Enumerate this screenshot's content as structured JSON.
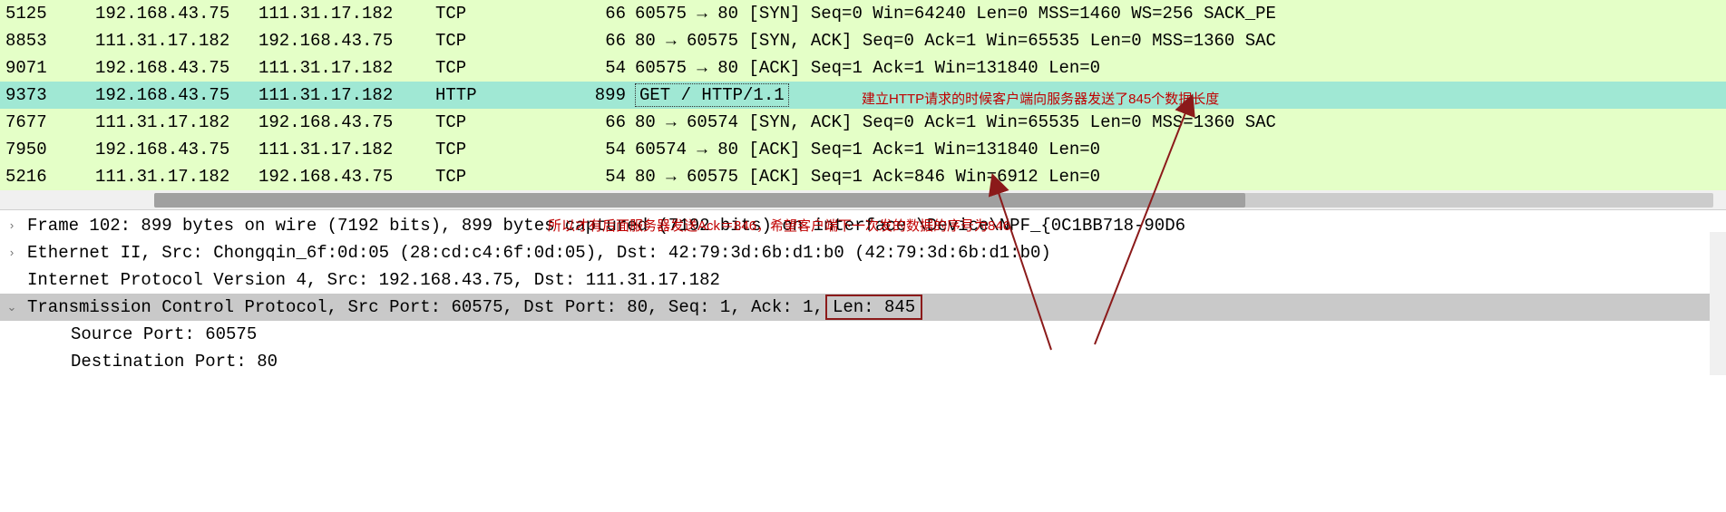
{
  "packets": [
    {
      "no": "5125",
      "src": "192.168.43.75",
      "dst": "111.31.17.182",
      "proto": "TCP",
      "len": "66",
      "info": "60575 → 80 [SYN] Seq=0 Win=64240 Len=0 MSS=1460 WS=256 SACK_PE",
      "cls": "row-green"
    },
    {
      "no": "8853",
      "src": "111.31.17.182",
      "dst": "192.168.43.75",
      "proto": "TCP",
      "len": "66",
      "info": "80 → 60575 [SYN, ACK] Seq=0 Ack=1 Win=65535 Len=0 MSS=1360 SAC",
      "cls": "row-green"
    },
    {
      "no": "9071",
      "src": "192.168.43.75",
      "dst": "111.31.17.182",
      "proto": "TCP",
      "len": "54",
      "info": "60575 → 80 [ACK] Seq=1 Ack=1 Win=131840 Len=0",
      "cls": "row-green"
    },
    {
      "no": "9373",
      "src": "192.168.43.75",
      "dst": "111.31.17.182",
      "proto": "HTTP",
      "len": "899",
      "info": "GET / HTTP/1.1 ",
      "cls": "row-teal",
      "boxed": true
    },
    {
      "no": "7677",
      "src": "111.31.17.182",
      "dst": "192.168.43.75",
      "proto": "TCP",
      "len": "66",
      "info": "80 → 60574 [SYN, ACK] Seq=0 Ack=1 Win=65535 Len=0 MSS=1360 SAC",
      "cls": "row-green"
    },
    {
      "no": "7950",
      "src": "192.168.43.75",
      "dst": "111.31.17.182",
      "proto": "TCP",
      "len": "54",
      "info": "60574 → 80 [ACK] Seq=1 Ack=1 Win=131840 Len=0",
      "cls": "row-green"
    },
    {
      "no": "5216",
      "src": "111.31.17.182",
      "dst": "192.168.43.75",
      "proto": "TCP",
      "len": "54",
      "info": "80 → 60575 [ACK] Seq=1 Ack=846 Win=6912 Len=0",
      "cls": "row-green"
    }
  ],
  "annot": {
    "top": "建立HTTP请求的时候客户端向服务器发送了845个数据长度",
    "mid": "所以才有后面服务器发送Ack＝846，希望客户端下一次发的数据的序号为846"
  },
  "details": {
    "frame": "Frame 102: 899 bytes on wire (7192 bits), 899 bytes captured (7192 bits) on interface \\Device\\NPF_{0C1BB718-90D6",
    "eth": "Ethernet II, Src: Chongqin_6f:0d:05 (28:cd:c4:6f:0d:05), Dst: 42:79:3d:6b:d1:b0 (42:79:3d:6b:d1:b0)",
    "ip": "Internet Protocol Version 4, Src: 192.168.43.75, Dst: 111.31.17.182",
    "tcp_pre": "Transmission Control Protocol, Src Port: 60575, Dst Port: 80, Seq: 1, Ack: 1, ",
    "tcp_len": "Len: 845",
    "srcport": "Source Port: 60575",
    "dstport": "Destination Port: 80"
  },
  "icons": {
    "collapsed": "›",
    "expanded": "⌄"
  }
}
